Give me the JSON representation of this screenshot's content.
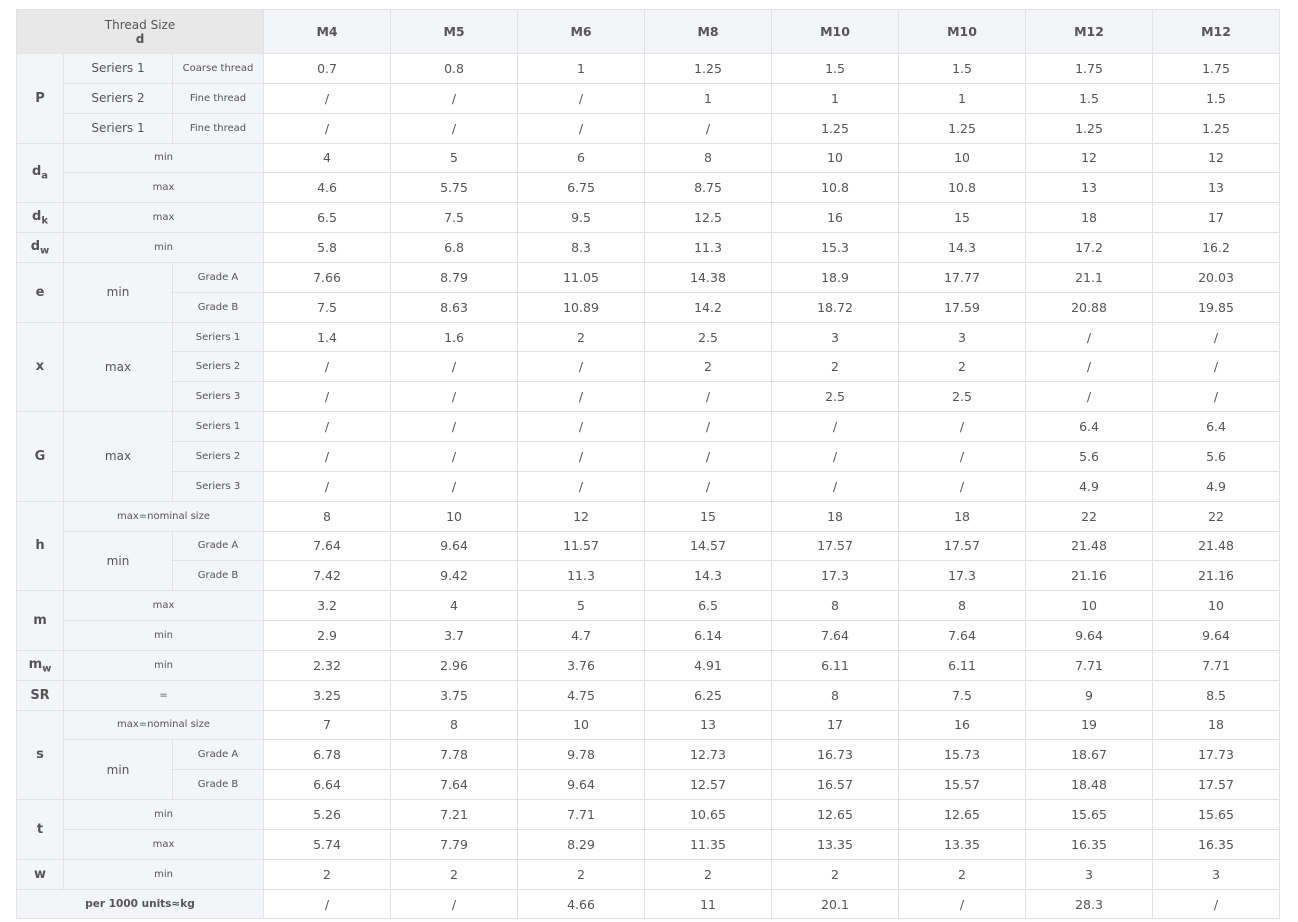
{
  "header": {
    "thread_size_label": "Thread Size",
    "d_label": "d",
    "sizes": [
      "M4",
      "M5",
      "M6",
      "M8",
      "M10",
      "M10",
      "M12",
      "M12"
    ]
  },
  "labels": {
    "P": "P",
    "da_main": "d",
    "da_sub": "a",
    "dk_main": "d",
    "dk_sub": "k",
    "dw_main": "d",
    "dw_sub": "w",
    "e": "e",
    "x": "x",
    "G": "G",
    "h": "h",
    "m": "m",
    "mw_main": "m",
    "mw_sub": "w",
    "SR": "SR",
    "s": "s",
    "t": "t",
    "w": "w",
    "seriers1": "Seriers 1",
    "seriers2": "Seriers 2",
    "coarse": "Coarse thread",
    "fine": "Fine thread",
    "min": "min",
    "max": "max",
    "grade_a": "Grade A",
    "grade_b": "Grade B",
    "sub_seriers1": "Seriers 1",
    "sub_seriers2": "Seriers 2",
    "sub_seriers3": "Seriers 3",
    "max_nominal": "max=nominal size",
    "equals": "=",
    "weight": "per 1000 units≈kg"
  },
  "rows": {
    "p_coarse": [
      "0.7",
      "0.8",
      "1",
      "1.25",
      "1.5",
      "1.5",
      "1.75",
      "1.75"
    ],
    "p_fine2": [
      "/",
      "/",
      "/",
      "1",
      "1",
      "1",
      "1.5",
      "1.5"
    ],
    "p_fine1": [
      "/",
      "/",
      "/",
      "/",
      "1.25",
      "1.25",
      "1.25",
      "1.25"
    ],
    "da_min": [
      "4",
      "5",
      "6",
      "8",
      "10",
      "10",
      "12",
      "12"
    ],
    "da_max": [
      "4.6",
      "5.75",
      "6.75",
      "8.75",
      "10.8",
      "10.8",
      "13",
      "13"
    ],
    "dk_max": [
      "6.5",
      "7.5",
      "9.5",
      "12.5",
      "16",
      "15",
      "18",
      "17"
    ],
    "dw_min": [
      "5.8",
      "6.8",
      "8.3",
      "11.3",
      "15.3",
      "14.3",
      "17.2",
      "16.2"
    ],
    "e_a": [
      "7.66",
      "8.79",
      "11.05",
      "14.38",
      "18.9",
      "17.77",
      "21.1",
      "20.03"
    ],
    "e_b": [
      "7.5",
      "8.63",
      "10.89",
      "14.2",
      "18.72",
      "17.59",
      "20.88",
      "19.85"
    ],
    "x_1": [
      "1.4",
      "1.6",
      "2",
      "2.5",
      "3",
      "3",
      "/",
      "/"
    ],
    "x_2": [
      "/",
      "/",
      "/",
      "2",
      "2",
      "2",
      "/",
      "/"
    ],
    "x_3": [
      "/",
      "/",
      "/",
      "/",
      "2.5",
      "2.5",
      "/",
      "/"
    ],
    "g_1": [
      "/",
      "/",
      "/",
      "/",
      "/",
      "/",
      "6.4",
      "6.4"
    ],
    "g_2": [
      "/",
      "/",
      "/",
      "/",
      "/",
      "/",
      "5.6",
      "5.6"
    ],
    "g_3": [
      "/",
      "/",
      "/",
      "/",
      "/",
      "/",
      "4.9",
      "4.9"
    ],
    "h_nom": [
      "8",
      "10",
      "12",
      "15",
      "18",
      "18",
      "22",
      "22"
    ],
    "h_a": [
      "7.64",
      "9.64",
      "11.57",
      "14.57",
      "17.57",
      "17.57",
      "21.48",
      "21.48"
    ],
    "h_b": [
      "7.42",
      "9.42",
      "11.3",
      "14.3",
      "17.3",
      "17.3",
      "21.16",
      "21.16"
    ],
    "m_max": [
      "3.2",
      "4",
      "5",
      "6.5",
      "8",
      "8",
      "10",
      "10"
    ],
    "m_min": [
      "2.9",
      "3.7",
      "4.7",
      "6.14",
      "7.64",
      "7.64",
      "9.64",
      "9.64"
    ],
    "mw_min": [
      "2.32",
      "2.96",
      "3.76",
      "4.91",
      "6.11",
      "6.11",
      "7.71",
      "7.71"
    ],
    "sr": [
      "3.25",
      "3.75",
      "4.75",
      "6.25",
      "8",
      "7.5",
      "9",
      "8.5"
    ],
    "s_nom": [
      "7",
      "8",
      "10",
      "13",
      "17",
      "16",
      "19",
      "18"
    ],
    "s_a": [
      "6.78",
      "7.78",
      "9.78",
      "12.73",
      "16.73",
      "15.73",
      "18.67",
      "17.73"
    ],
    "s_b": [
      "6.64",
      "7.64",
      "9.64",
      "12.57",
      "16.57",
      "15.57",
      "18.48",
      "17.57"
    ],
    "t_min": [
      "5.26",
      "7.21",
      "7.71",
      "10.65",
      "12.65",
      "12.65",
      "15.65",
      "15.65"
    ],
    "t_max": [
      "5.74",
      "7.79",
      "8.29",
      "11.35",
      "13.35",
      "13.35",
      "16.35",
      "16.35"
    ],
    "w_min": [
      "2",
      "2",
      "2",
      "2",
      "2",
      "2",
      "3",
      "3"
    ],
    "weight": [
      "/",
      "/",
      "4.66",
      "11",
      "20.1",
      "/",
      "28.3",
      "/"
    ]
  }
}
